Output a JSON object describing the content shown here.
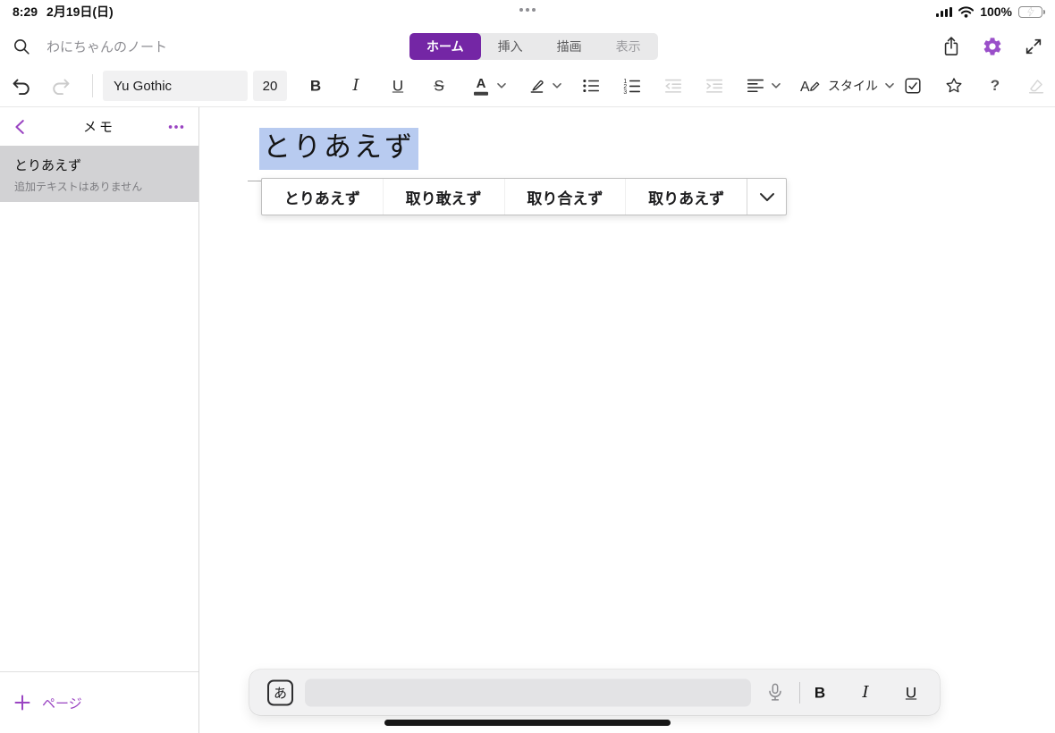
{
  "colors": {
    "accent": "#7426a5",
    "accent-light": "#9a44c2",
    "selection": "#b8cbf0",
    "battery-green": "#35c759"
  },
  "status_bar": {
    "time": "8:29",
    "date": "2月19日(日)",
    "battery_percent": "100%"
  },
  "header": {
    "notebook_name": "わにちゃんのノート",
    "tabs": [
      {
        "label": "ホーム",
        "selected": true
      },
      {
        "label": "挿入",
        "selected": false
      },
      {
        "label": "描画",
        "selected": false
      },
      {
        "label": "表示",
        "selected": false
      }
    ]
  },
  "toolbar": {
    "font_name": "Yu Gothic",
    "font_size": "20",
    "bold": "B",
    "italic": "I",
    "underline": "U",
    "strikethrough": "S",
    "font_color": "A",
    "style_label": "スタイル",
    "help": "?"
  },
  "sidebar": {
    "title": "メモ",
    "notes": [
      {
        "title": "とりあえず",
        "subtitle": "追加テキストはありません",
        "selected": true
      }
    ],
    "add_page_label": "ページ"
  },
  "editor": {
    "title_text": "とりあえず"
  },
  "ime": {
    "input_mode_key": "あ",
    "candidates": [
      "とりあえず",
      "取り敢えず",
      "取り合えず",
      "取りあえず"
    ],
    "bold": "B",
    "italic": "I",
    "underline": "U"
  }
}
